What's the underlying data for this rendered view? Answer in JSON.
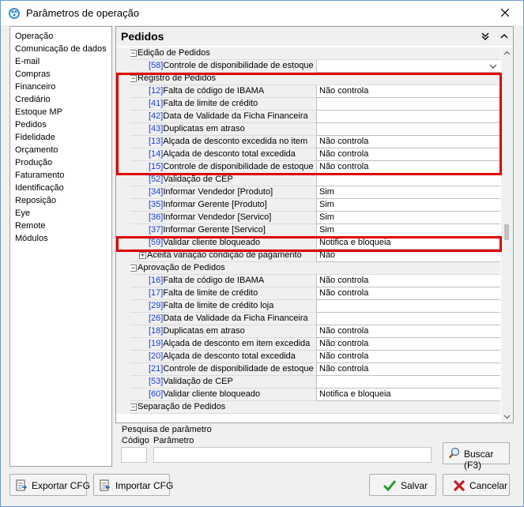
{
  "window": {
    "title": "Parâmetros de operação"
  },
  "nav": {
    "items": [
      "Operação",
      "Comunicação de dados",
      "E-mail",
      "Compras",
      "Financeiro",
      "Crediário",
      "Estoque MP",
      "Pedidos",
      "Fidelidade",
      "Orçamento",
      "Produção",
      "Faturamento",
      "Identificação",
      "Reposição",
      "Eye",
      "Remote",
      "Módulos"
    ]
  },
  "panel": {
    "title": "Pedidos"
  },
  "rows": [
    {
      "type": "cat",
      "label": "Edição de Pedidos",
      "sign": "−"
    },
    {
      "type": "param",
      "code": "[58]",
      "label": "Controle de disponibilidade de estoque",
      "value": "",
      "dropdown": true
    },
    {
      "type": "cat",
      "label": "Registro de Pedidos",
      "sign": "−"
    },
    {
      "type": "param",
      "code": "[12]",
      "label": "Falta de código de IBAMA",
      "value": "Não controla"
    },
    {
      "type": "param",
      "code": "[41]",
      "label": "Falta de limite de crédito",
      "value": ""
    },
    {
      "type": "param",
      "code": "[42]",
      "label": "Data de Validade da Ficha Financeira",
      "value": ""
    },
    {
      "type": "param",
      "code": "[43]",
      "label": "Duplicatas em atraso",
      "value": ""
    },
    {
      "type": "param",
      "code": "[13]",
      "label": "Alçada de desconto excedida no item",
      "value": "Não controla"
    },
    {
      "type": "param",
      "code": "[14]",
      "label": "Alçada de desconto total excedida",
      "value": "Não controla"
    },
    {
      "type": "param",
      "code": "[15]",
      "label": "Controle de disponibilidade de estoque",
      "value": "Não controla"
    },
    {
      "type": "param",
      "code": "[52]",
      "label": "Validação de CEP",
      "value": ""
    },
    {
      "type": "param",
      "code": "[34]",
      "label": "Informar Vendedor [Produto]",
      "value": "Sim"
    },
    {
      "type": "param",
      "code": "[35]",
      "label": "Informar Gerente [Produto]",
      "value": "Sim"
    },
    {
      "type": "param",
      "code": "[36]",
      "label": "Informar Vendedor [Servico]",
      "value": "Sim"
    },
    {
      "type": "param",
      "code": "[37]",
      "label": "Informar Gerente [Servico]",
      "value": "Sim"
    },
    {
      "type": "param",
      "code": "[59]",
      "label": "Validar cliente bloqueado",
      "value": "Notifica e bloqueia"
    },
    {
      "type": "subcat",
      "label": "Aceita variação condição de pagamento",
      "value": "Não",
      "sign": "+"
    },
    {
      "type": "cat",
      "label": "Aprovação de Pedidos",
      "sign": "−"
    },
    {
      "type": "param",
      "code": "[16]",
      "label": "Falta de código de IBAMA",
      "value": "Não controla"
    },
    {
      "type": "param",
      "code": "[17]",
      "label": "Falta de limite de crédito",
      "value": "Não controla"
    },
    {
      "type": "param",
      "code": "[29]",
      "label": "Falta de limite de crédito loja",
      "value": ""
    },
    {
      "type": "param",
      "code": "[26]",
      "label": "Data de Validade da Ficha Financeira",
      "value": ""
    },
    {
      "type": "param",
      "code": "[18]",
      "label": "Duplicatas em atraso",
      "value": "Não controla"
    },
    {
      "type": "param",
      "code": "[19]",
      "label": "Alçada de desconto em item excedida",
      "value": "Não controla"
    },
    {
      "type": "param",
      "code": "[20]",
      "label": "Alçada de desconto total excedida",
      "value": "Não controla"
    },
    {
      "type": "param",
      "code": "[21]",
      "label": "Controle de disponibilidade de estoque",
      "value": "Não controla"
    },
    {
      "type": "param",
      "code": "[53]",
      "label": "Validação de CEP",
      "value": ""
    },
    {
      "type": "param",
      "code": "[60]",
      "label": "Validar cliente bloqueado",
      "value": "Notifica e bloqueia"
    },
    {
      "type": "cat",
      "label": "Separação de Pedidos",
      "sign": "−"
    }
  ],
  "search": {
    "legend": "Pesquisa de parâmetro",
    "code_label": "Código",
    "param_label": "Parâmetro",
    "button": "Buscar (F3)"
  },
  "buttons": {
    "export": "Exportar CFG",
    "import": "Importar CFG",
    "save": "Salvar",
    "cancel": "Cancelar"
  },
  "icons": {
    "app": "gear-cluster-icon",
    "close": "close-icon",
    "collapse_down": "double-chevron-down-icon",
    "collapse_up": "chevron-up-icon",
    "search": "magnifier-icon",
    "export": "export-document-icon",
    "import": "import-document-icon",
    "save": "checkmark-icon",
    "cancel": "x-icon"
  },
  "colors": {
    "highlight": "#e00000",
    "code_link": "#1a3fd1",
    "check_green": "#2a9d2a",
    "cancel_red": "#c81e1e"
  }
}
